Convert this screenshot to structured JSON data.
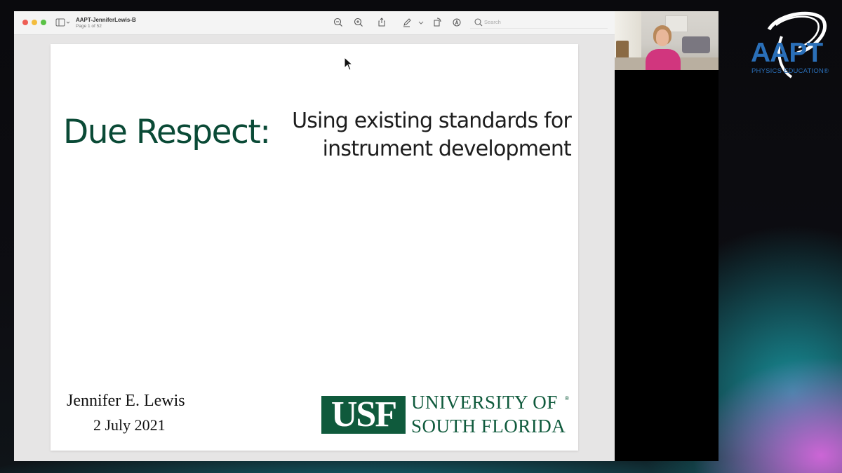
{
  "window": {
    "document_name": "AAPT-JenniferLewis-B",
    "page_count": "Page 1 of 52",
    "search_placeholder": "Search"
  },
  "slide": {
    "title": "Due Respect:",
    "subtitle_lines": [
      "Using existing standards for",
      "instrument development"
    ],
    "author": "Jennifer E. Lewis",
    "date": "2 July 2021",
    "university_abbrev": "USF",
    "university_line1": "UNIVERSITY OF",
    "university_line2": "SOUTH FLORIDA",
    "registered_mark": "®"
  },
  "logo": {
    "name": "AAPT",
    "tagline": "PHYSICS EDUCATION®"
  },
  "colors": {
    "title_green": "#0a4a36",
    "usf_green": "#0f5a3c",
    "aapt_blue": "#2a6fb8"
  },
  "icons": {
    "window_controls": [
      "close-icon",
      "minimize-icon",
      "zoom-icon"
    ],
    "toolbar": [
      "sidebar-icon",
      "zoom-out-icon",
      "zoom-in-icon",
      "share-icon",
      "markup-pen-icon",
      "chevron-down-icon",
      "rotate-icon",
      "annotate-icon",
      "search-icon"
    ]
  }
}
